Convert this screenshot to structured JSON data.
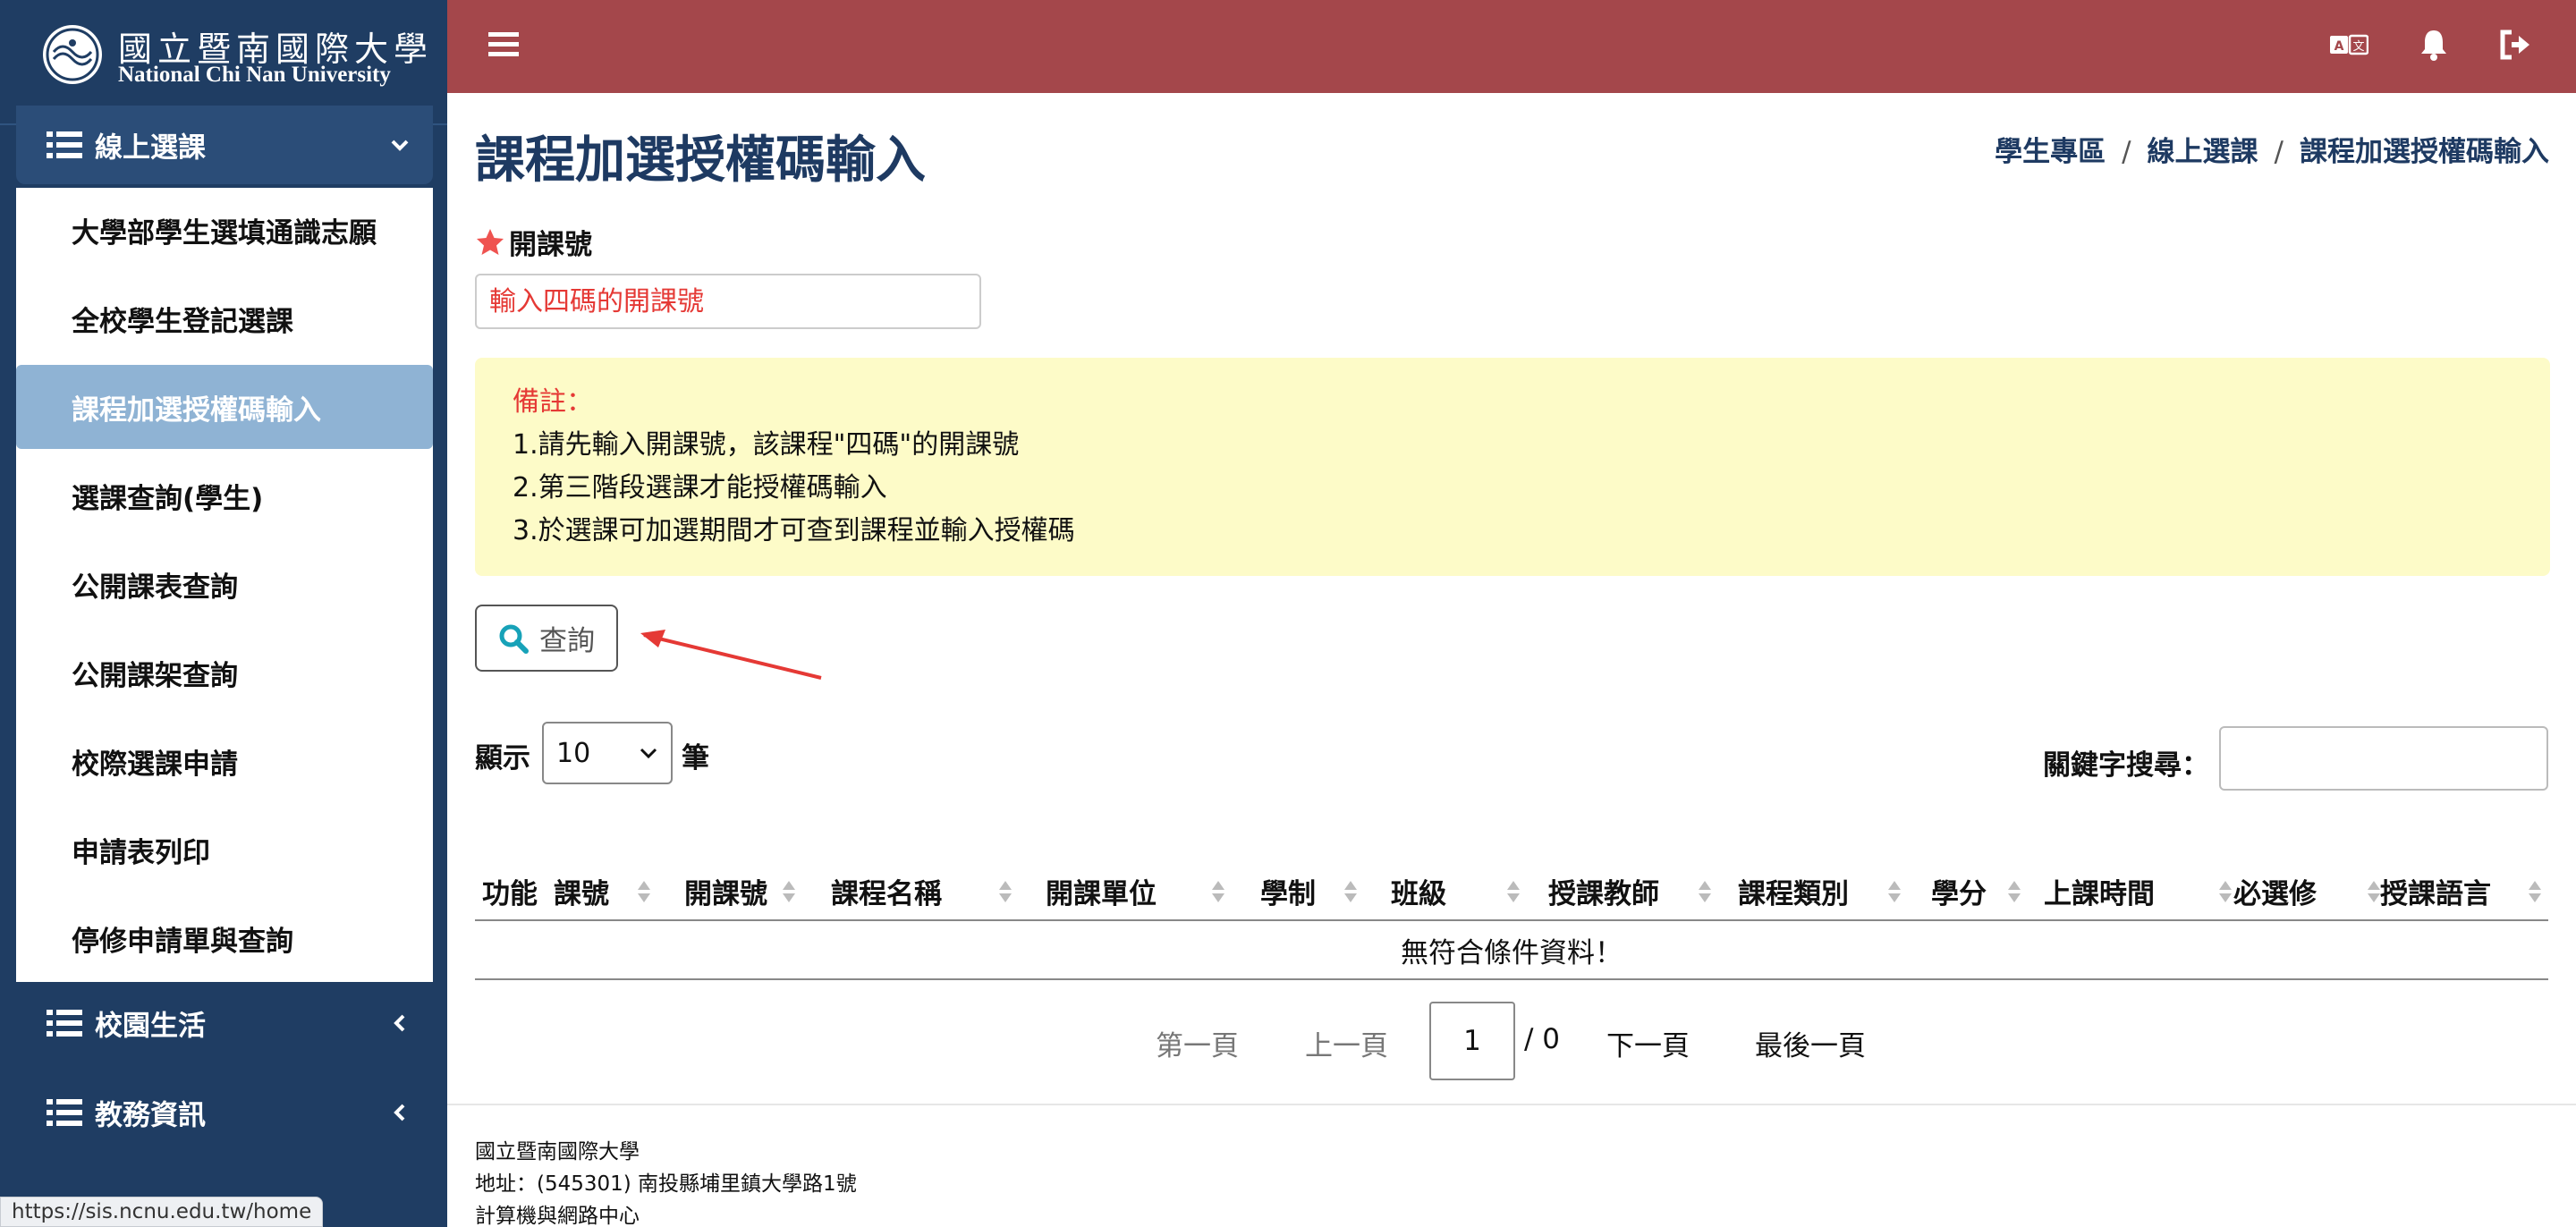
{
  "brand": {
    "name_zh": "國立暨南國際大學",
    "name_en": "National Chi Nan University"
  },
  "sidebar": {
    "menus": [
      {
        "label": "線上選課",
        "state": "open"
      },
      {
        "label": "校園生活",
        "state": "collapsed"
      },
      {
        "label": "教務資訊",
        "state": "collapsed"
      }
    ],
    "submenu_items": [
      {
        "label": "大學部學生選填通識志願"
      },
      {
        "label": "全校學生登記選課"
      },
      {
        "label": "課程加選授權碼輸入",
        "active": true
      },
      {
        "label": "選課查詢(學生)"
      },
      {
        "label": "公開課表查詢"
      },
      {
        "label": "公開課架查詢"
      },
      {
        "label": "校際選課申請"
      },
      {
        "label": "申請表列印"
      },
      {
        "label": "停修申請單與查詢"
      }
    ]
  },
  "topbar": {
    "color": "#a4474b",
    "icons": [
      "menu-icon",
      "translate-icon",
      "bell-icon",
      "logout-icon"
    ]
  },
  "page": {
    "title": "課程加選授權碼輸入",
    "breadcrumb": [
      "學生專區",
      "線上選課",
      "課程加選授權碼輸入"
    ]
  },
  "form": {
    "course_code_label": "開課號",
    "course_code_placeholder": "輸入四碼的開課號",
    "course_code_value": ""
  },
  "note": {
    "title": "備註：",
    "lines": [
      "1.請先輸入開課號，該課程\"四碼\"的開課號",
      "2.第三階段選課才能授權碼輸入",
      "3.於選課可加選期間才可查到課程並輸入授權碼"
    ]
  },
  "query_button": {
    "label": "查詢",
    "icon": "search-icon"
  },
  "table_controls": {
    "show_label": "顯示",
    "page_size": "10",
    "unit_label": "筆",
    "search_label": "關鍵字搜尋：",
    "search_value": ""
  },
  "table": {
    "columns": [
      "功能",
      "課號",
      "開課號",
      "課程名稱",
      "開課單位",
      "學制",
      "班級",
      "授課教師",
      "課程類別",
      "學分",
      "上課時間",
      "必選修",
      "授課語言"
    ],
    "empty_message": "無符合條件資料！"
  },
  "pagination": {
    "first": "第一頁",
    "prev": "上一頁",
    "current_page": "1",
    "total_label": "/ 0",
    "next": "下一頁",
    "last": "最後一頁"
  },
  "footer": {
    "lines": [
      "國立暨南國際大學",
      "地址：(545301) 南投縣埔里鎮大學路1號",
      "計算機與網路中心"
    ]
  },
  "status_bar": {
    "url": "https://sis.ncnu.edu.tw/home"
  },
  "colors": {
    "sidebar": "#1f3d63",
    "active_item": "#8fb3d4",
    "title": "#1e3a62",
    "note_background": "#fdfbc8",
    "note_title": "#e53935",
    "annotation_arrow": "#e53935"
  }
}
